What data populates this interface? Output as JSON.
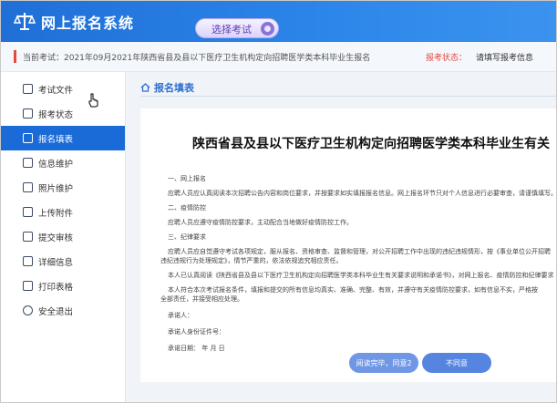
{
  "header": {
    "app_title": "网上报名系统",
    "select_exam_label": "选择考试"
  },
  "exam_info": {
    "current_exam": "当前考试：2021年09月2021年陕西省县及县以下医疗卫生机构定向招聘医学类本科毕业生报名",
    "status_label": "报考状态：",
    "status_value": "请填写报考信息"
  },
  "sidebar": {
    "items": [
      {
        "label": "考试文件",
        "icon": "document-icon",
        "active": false
      },
      {
        "label": "报考状态",
        "icon": "monitor-icon",
        "active": false
      },
      {
        "label": "报名填表",
        "icon": "pencil-icon",
        "active": true
      },
      {
        "label": "信息维护",
        "icon": "form-icon",
        "active": false
      },
      {
        "label": "照片维护",
        "icon": "photo-icon",
        "active": false
      },
      {
        "label": "上传附件",
        "icon": "upload-icon",
        "active": false
      },
      {
        "label": "提交审核",
        "icon": "submit-icon",
        "active": false
      },
      {
        "label": "详细信息",
        "icon": "detail-icon",
        "active": false
      },
      {
        "label": "打印表格",
        "icon": "printer-icon",
        "active": false
      },
      {
        "label": "安全退出",
        "icon": "power-icon",
        "active": false
      }
    ]
  },
  "main": {
    "breadcrumb": "报名填表",
    "document": {
      "title": "陕西省县及县以下医疗卫生机构定向招聘医学类本科毕业生有关",
      "paragraphs": [
        "一、网上报名",
        "应聘人员应认真阅读本次招聘公告内容和岗位要求，并按要求如实填报报名信息。网上报名环节只对个人信息进行必要审查，请谨慎填写。",
        "二、疫情防控",
        "应聘人员应遵守疫情防控要求，主动配合当地做好疫情防控工作。",
        "三、纪律要求",
        "应聘人员应自觉遵守考试各项规定，服从报名、资格审查、监督和管理，对公开招聘工作中出现的违纪违规情形，按《事业单位公开招聘",
        "违纪违规行为处理规定》，情节严重的，依法依规追究相应责任。",
        "本人已认真阅读《陕西省县及县以下医疗卫生机构定向招聘医学类本科毕业生有关要求说明和承诺书》，对网上报名、疫情防控和纪律要求",
        "本人符合本次考试报名条件，填报和提交的所有信息均真实、准确、完整、有效，并遵守有关疫情防控要求，如有信息不实，严格按",
        "全部责任，并接受相应处理。",
        "承诺人：",
        "承诺人身份证件号：",
        "承诺日期：    年   月   日"
      ]
    },
    "agree_button": "阅读完毕，同意2",
    "disagree_button": "不同意"
  }
}
